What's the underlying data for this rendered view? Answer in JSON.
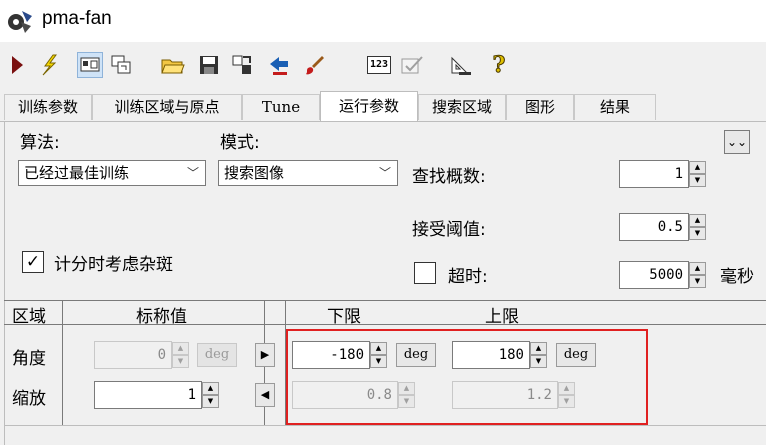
{
  "window": {
    "title": "pma-fan"
  },
  "toolbar": {
    "icons": [
      "play-icon",
      "lightning-icon",
      "view-toggle-icon",
      "window-arrange-icon",
      "open-folder-icon",
      "save-icon",
      "export-icon",
      "import-icon",
      "brush-icon",
      "counter-icon",
      "checkmark-icon",
      "geometry-icon",
      "help-icon"
    ],
    "counter_label": "123",
    "help_label": "?"
  },
  "tabs": [
    {
      "label": "训练参数"
    },
    {
      "label": "训练区域与原点"
    },
    {
      "label": "Tune"
    },
    {
      "label": "运行参数"
    },
    {
      "label": "搜索区域"
    },
    {
      "label": "图形"
    },
    {
      "label": "结果"
    }
  ],
  "run_params": {
    "algorithm_label": "算法:",
    "algorithm_value": "已经过最佳训练",
    "mode_label": "模式:",
    "mode_value": "搜索图像",
    "find_count_label": "查找概数:",
    "find_count_value": "1",
    "accept_threshold_label": "接受阈值:",
    "accept_threshold_value": "0.5",
    "clutter_label": "计分时考虑杂斑",
    "clutter_checked": true,
    "timeout_label": "超时:",
    "timeout_checked": false,
    "timeout_value": "5000",
    "timeout_unit": "毫秒"
  },
  "dof_table": {
    "headers": {
      "zone": "区域",
      "nominal": "标称值",
      "low": "下限",
      "high": "上限"
    },
    "rows": [
      {
        "name": "角度",
        "nominal": "0",
        "nominal_unit": "deg",
        "low": "-180",
        "low_unit": "deg",
        "high": "180",
        "high_unit": "deg"
      },
      {
        "name": "缩放",
        "nominal": "1",
        "low": "0.8",
        "high": "1.2"
      }
    ]
  },
  "colors": {
    "highlight": "#e02020",
    "accent": "#1a5fb4"
  }
}
